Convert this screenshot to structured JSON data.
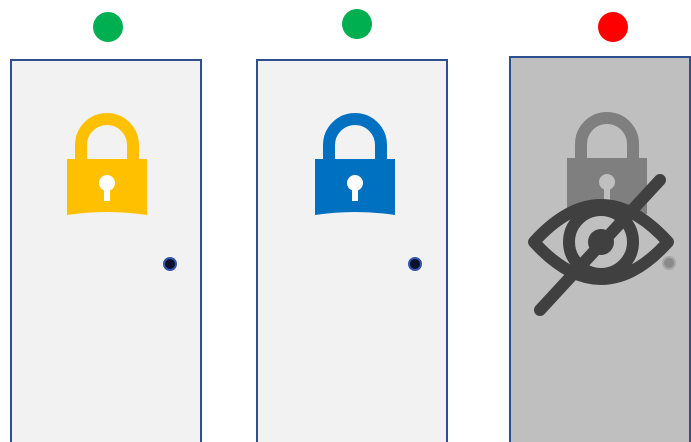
{
  "doors": [
    {
      "id": "door-1",
      "status": "available",
      "status_color": "#00b050",
      "door_fill": "#f2f2f2",
      "door_border": "#2f4f8f",
      "lock_icon": "padlock-icon",
      "lock_color": "#ffc000",
      "knob_icon": "door-knob",
      "hidden": false
    },
    {
      "id": "door-2",
      "status": "available",
      "status_color": "#00b050",
      "door_fill": "#f2f2f2",
      "door_border": "#2f4f8f",
      "lock_icon": "padlock-icon",
      "lock_color": "#0070c0",
      "knob_icon": "door-knob",
      "hidden": false
    },
    {
      "id": "door-3",
      "status": "unavailable",
      "status_color": "#ff0000",
      "door_fill": "#bfbfbf",
      "door_border": "#2f4f8f",
      "lock_icon": "padlock-icon",
      "lock_color": "#7f7f7f",
      "knob_icon": "door-knob",
      "hidden": true,
      "overlay_icon": "eye-slash-icon",
      "overlay_color": "#404040"
    }
  ]
}
